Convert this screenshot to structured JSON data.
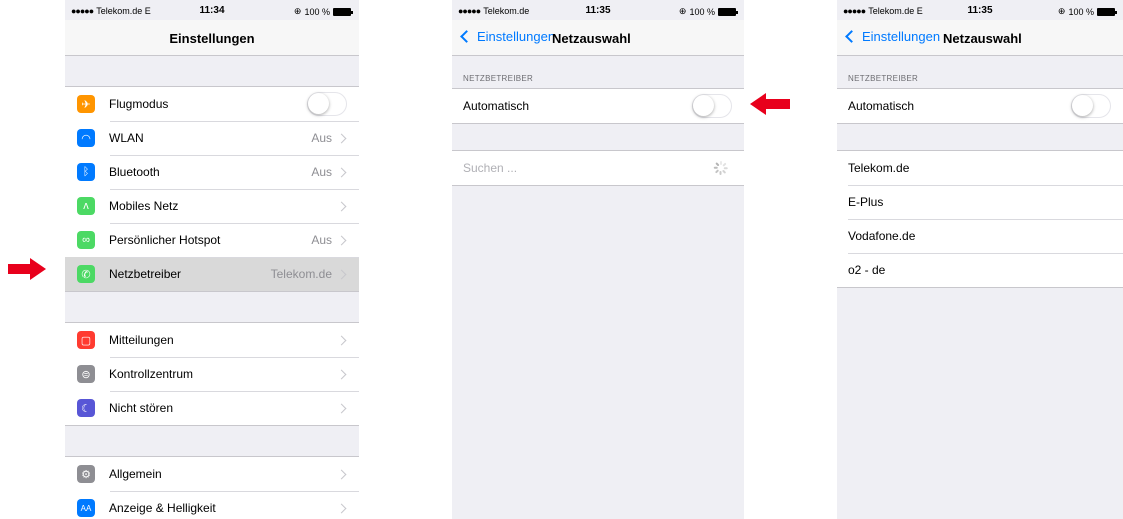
{
  "screen1": {
    "status": {
      "carrier": "Telekom.de  E",
      "time": "11:34",
      "battery": "100 %"
    },
    "title": "Einstellungen",
    "group1": [
      {
        "label": "Flugmodus",
        "value": "",
        "icon": "airplane-icon",
        "color": "#ff9500"
      },
      {
        "label": "WLAN",
        "value": "Aus",
        "icon": "wifi-icon",
        "color": "#007aff"
      },
      {
        "label": "Bluetooth",
        "value": "Aus",
        "icon": "bluetooth-icon",
        "color": "#007aff"
      },
      {
        "label": "Mobiles Netz",
        "value": "",
        "icon": "antenna-icon",
        "color": "#4cd964"
      },
      {
        "label": "Persönlicher Hotspot",
        "value": "Aus",
        "icon": "hotspot-icon",
        "color": "#4cd964"
      },
      {
        "label": "Netzbetreiber",
        "value": "Telekom.de",
        "icon": "phone-icon",
        "color": "#4cd964"
      }
    ],
    "group2": [
      {
        "label": "Mitteilungen",
        "icon": "notifications-icon",
        "color": "#ff3b30"
      },
      {
        "label": "Kontrollzentrum",
        "icon": "control-center-icon",
        "color": "#8e8e93"
      },
      {
        "label": "Nicht stören",
        "icon": "moon-icon",
        "color": "#5856d6"
      }
    ],
    "group3": [
      {
        "label": "Allgemein",
        "icon": "gear-icon",
        "color": "#8e8e93"
      },
      {
        "label": "Anzeige & Helligkeit",
        "icon": "display-icon",
        "color": "#007aff",
        "glyph": "AA"
      }
    ]
  },
  "screen2": {
    "status": {
      "carrier": "Telekom.de",
      "time": "11:35",
      "battery": "100 %"
    },
    "back": "Einstellungen",
    "title": "Netzauswahl",
    "section_header": "NETZBETREIBER",
    "automatic_label": "Automatisch",
    "search_label": "Suchen ..."
  },
  "screen3": {
    "status": {
      "carrier": "Telekom.de  E",
      "time": "11:35",
      "battery": "100 %"
    },
    "back": "Einstellungen",
    "title": "Netzauswahl",
    "section_header": "NETZBETREIBER",
    "automatic_label": "Automatisch",
    "networks": [
      "Telekom.de",
      "E-Plus",
      "Vodafone.de",
      "o2 - de"
    ]
  }
}
